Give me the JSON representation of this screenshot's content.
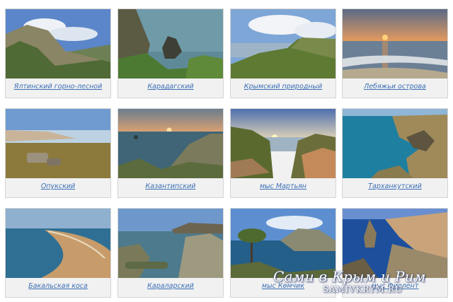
{
  "cards": [
    {
      "caption": "Ялтинский горно-лесной"
    },
    {
      "caption": "Карадагский"
    },
    {
      "caption": "Крымский природный"
    },
    {
      "caption": "Лебяжьи острова"
    },
    {
      "caption": "Опукский"
    },
    {
      "caption": "Казантипский"
    },
    {
      "caption": "мыс Мартьян"
    },
    {
      "caption": "Тарханкутский"
    },
    {
      "caption": "Бакальская коса"
    },
    {
      "caption": "Караларский"
    },
    {
      "caption": "мыс Көмчик"
    },
    {
      "caption": "мыс Фиолент"
    }
  ],
  "watermark": {
    "title": "Сами в Крым и Рим",
    "site": "SAMIVKRYM.RU"
  }
}
